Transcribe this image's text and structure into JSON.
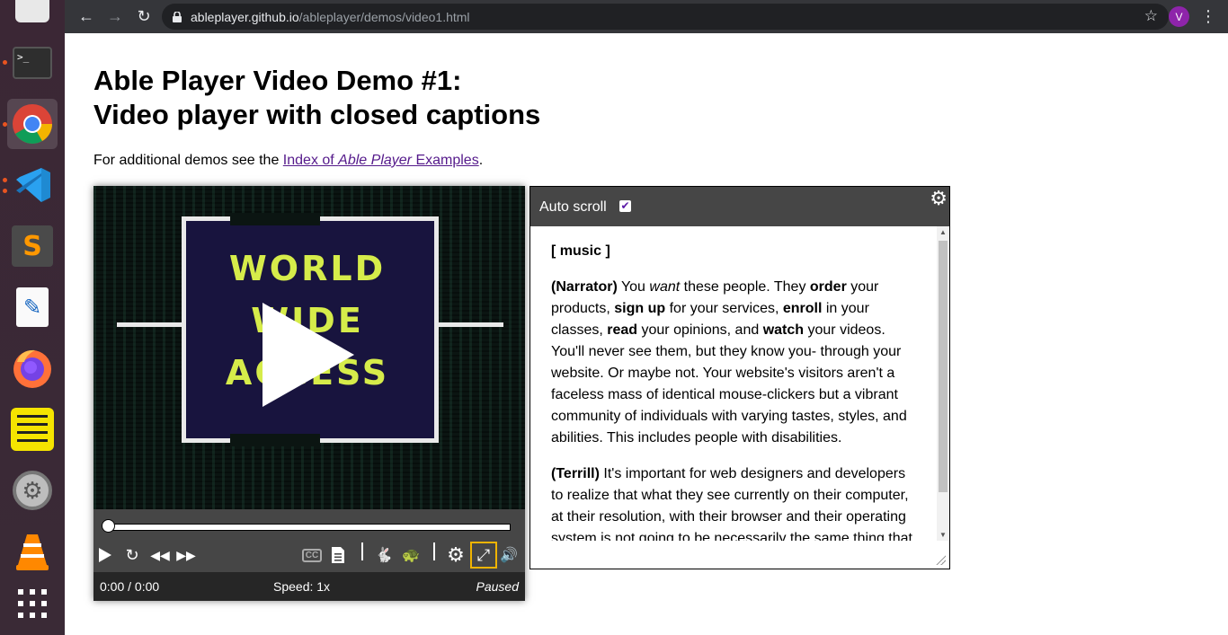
{
  "browser": {
    "url_host": "ableplayer.github.io",
    "url_path": "/ableplayer/demos/video1.html",
    "profile_initial": "V"
  },
  "dock": {
    "apps": [
      "files",
      "terminal",
      "chrome",
      "vscode",
      "sublime-text",
      "text-editor",
      "firefox",
      "notes",
      "settings",
      "vlc",
      "show-apps"
    ]
  },
  "page": {
    "title_line1": "Able Player Video Demo #1:",
    "title_line2": "Video player with closed captions",
    "intro_text": "For additional demos see the ",
    "intro_link_a": "Index of ",
    "intro_link_italic": "Able Player",
    "intro_link_b": " Examples",
    "intro_period": "."
  },
  "video": {
    "logo_line1": "WORLD",
    "logo_line2": "WIDE",
    "logo_line3": "ACCESS",
    "time": "0:00 / 0:00",
    "speed": "Speed: 1x",
    "state": "Paused",
    "progress": 0
  },
  "transcript": {
    "auto_scroll_label": "Auto scroll",
    "auto_scroll_checked": true,
    "p1": "[ music ]",
    "p2_speaker": "(Narrator)",
    "p2": [
      {
        "t": " You ",
        "s": "normal"
      },
      {
        "t": "want",
        "s": "italic"
      },
      {
        "t": " these people. They ",
        "s": "normal"
      },
      {
        "t": "order",
        "s": "bold"
      },
      {
        "t": " your products, ",
        "s": "normal"
      },
      {
        "t": "sign up",
        "s": "bold"
      },
      {
        "t": " for your services, ",
        "s": "normal"
      },
      {
        "t": "enroll",
        "s": "bold"
      },
      {
        "t": " in your classes, ",
        "s": "normal"
      },
      {
        "t": "read",
        "s": "bold"
      },
      {
        "t": " your opinions, and ",
        "s": "normal"
      },
      {
        "t": "watch",
        "s": "bold"
      },
      {
        "t": " your videos. You'll never see them, but they know you- through your website. Or maybe not. Your website's visitors aren't a faceless mass of identical mouse-clickers but a vibrant community of individuals with varying tastes, styles, and abilities. This includes people with disabilities.",
        "s": "normal"
      }
    ],
    "p3_speaker": "(Terrill)",
    "p3": " It's important for web designers and developers to realize that what they see currently on their computer, at their resolution, with their browser and their operating system is not going to be necessarily the same thing that"
  },
  "colors": {
    "control_bar": "#464646",
    "status_bar": "#262626",
    "link_visited": "#551a8b",
    "logo_text": "#d6ec4a",
    "focus_outline": "#f0b400"
  }
}
